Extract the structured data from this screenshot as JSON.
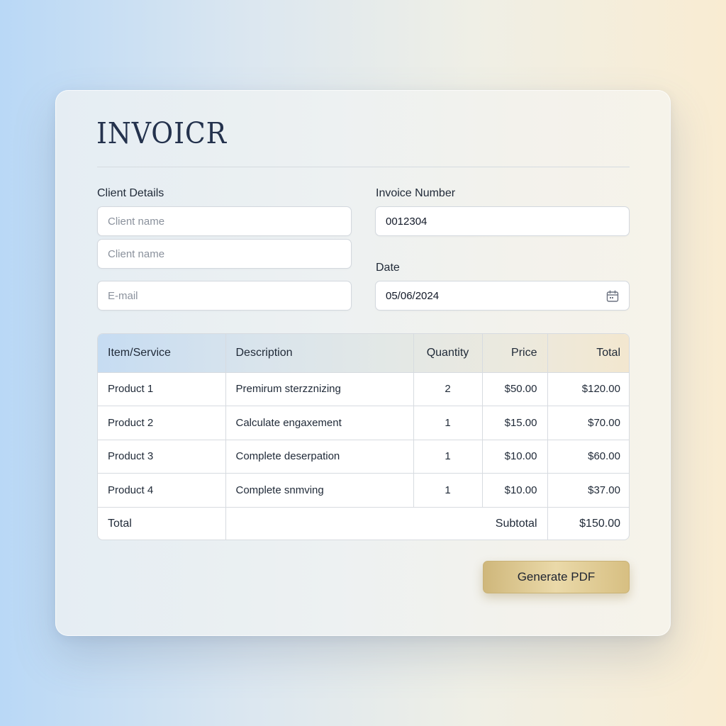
{
  "app": {
    "logo": "INVOICR"
  },
  "client": {
    "label": "Client Details",
    "name_placeholder_1": "Client name",
    "name_placeholder_2": "Client name",
    "email_placeholder": "E-mail"
  },
  "invoice": {
    "number_label": "Invoice Number",
    "number_value": "0012304",
    "date_label": "Date",
    "date_value": "05/06/2024"
  },
  "table": {
    "headers": [
      "Item/Service",
      "Description",
      "Quantity",
      "Price",
      "Total"
    ],
    "rows": [
      {
        "item": "Product 1",
        "description": "Premirum sterᴢᴢnizing",
        "quantity": "2",
        "price": "$50.00",
        "total": "$120.00"
      },
      {
        "item": "Product 2",
        "description": "Calculate engaxement",
        "quantity": "1",
        "price": "$15.00",
        "total": "$70.00"
      },
      {
        "item": "Product 3",
        "description": "Complete deserpation",
        "quantity": "1",
        "price": "$10.00",
        "total": "$60.00"
      },
      {
        "item": "Product 4",
        "description": "Complete snmving",
        "quantity": "1",
        "price": "$10.00",
        "total": "$37.00"
      }
    ],
    "footer": {
      "total_label": "Total",
      "subtotal_label": "Subtotal",
      "subtotal_value": "$150.00"
    }
  },
  "actions": {
    "generate_pdf": "Generate PDF"
  },
  "icons": {
    "date_field_icon": "calendar-icon"
  },
  "colors": {
    "accent_gold": "#d9c38a",
    "logo_navy": "#24324d"
  }
}
